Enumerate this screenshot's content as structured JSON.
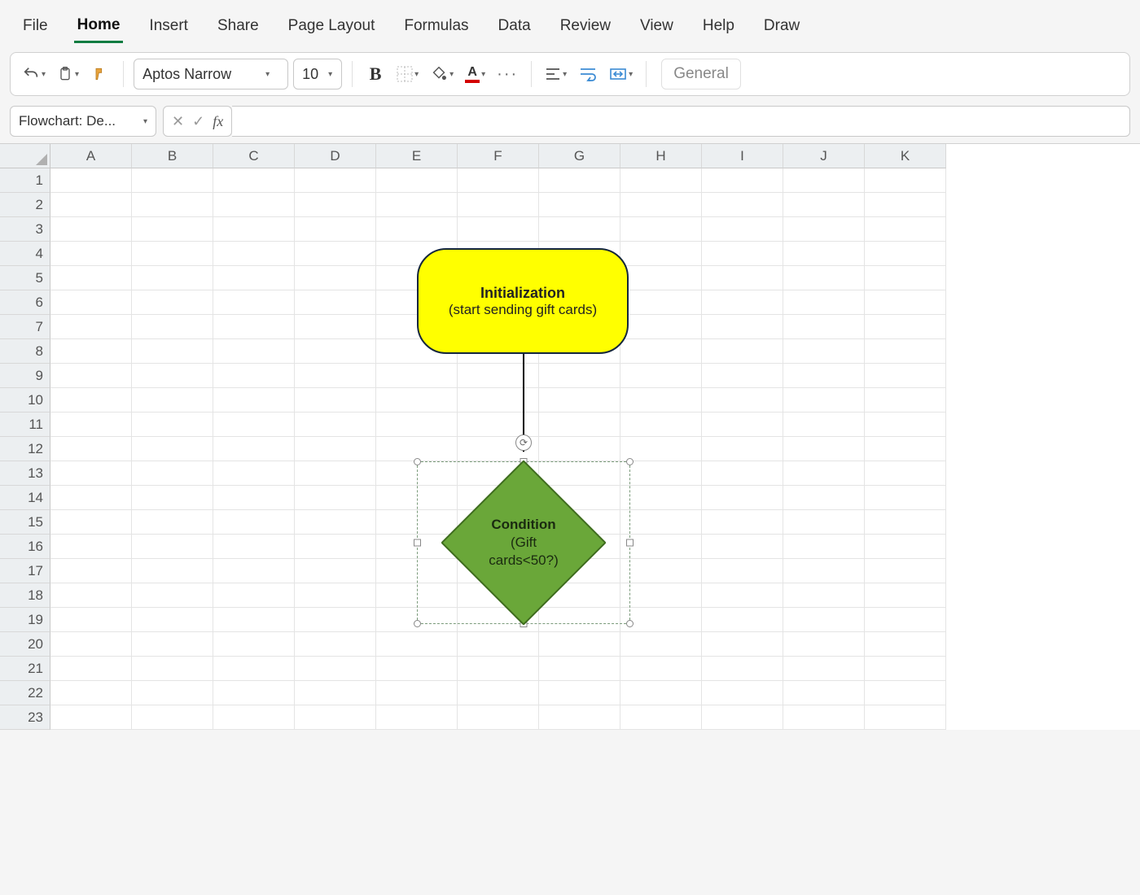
{
  "tabs": {
    "file": "File",
    "home": "Home",
    "insert": "Insert",
    "share": "Share",
    "page_layout": "Page Layout",
    "formulas": "Formulas",
    "data": "Data",
    "review": "Review",
    "view": "View",
    "help": "Help",
    "draw": "Draw"
  },
  "toolbar": {
    "font_name": "Aptos Narrow",
    "font_size": "10",
    "number_format": "General"
  },
  "namebox": "Flowchart: De...",
  "fx_label": "fx",
  "columns": [
    "A",
    "B",
    "C",
    "D",
    "E",
    "F",
    "G",
    "H",
    "I",
    "J",
    "K"
  ],
  "rows": [
    "1",
    "2",
    "3",
    "4",
    "5",
    "6",
    "7",
    "8",
    "9",
    "10",
    "11",
    "12",
    "13",
    "14",
    "15",
    "16",
    "17",
    "18",
    "19",
    "20",
    "21",
    "22",
    "23"
  ],
  "shapes": {
    "terminator": {
      "title": "Initialization",
      "subtitle": "(start sending gift cards)"
    },
    "decision": {
      "title": "Condition",
      "line2": "(Gift",
      "line3": "cards<50?)"
    }
  }
}
